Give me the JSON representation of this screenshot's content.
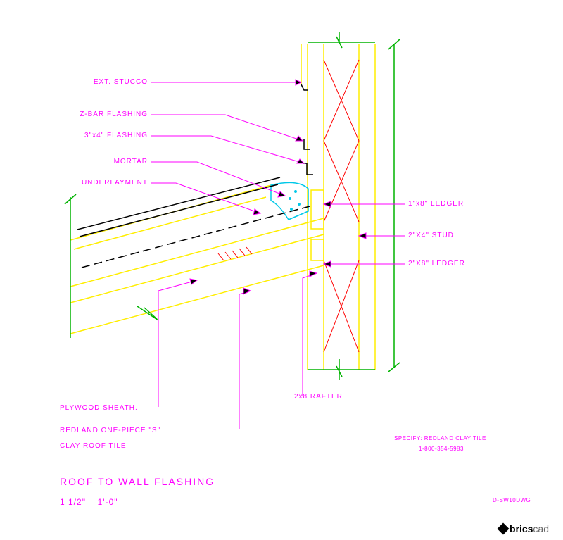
{
  "labels_left": [
    {
      "id": "ext-stucco",
      "text": "EXT. STUCCO"
    },
    {
      "id": "zbar-flashing",
      "text": "Z-BAR FLASHING"
    },
    {
      "id": "3x4-flashing",
      "text": "3\"x4\" FLASHING"
    },
    {
      "id": "mortar",
      "text": "MORTAR"
    },
    {
      "id": "underlayment",
      "text": "UNDERLAYMENT"
    }
  ],
  "labels_right": [
    {
      "id": "ledger-1x8",
      "text": "1\"x8\" LEDGER"
    },
    {
      "id": "stud-2x4",
      "text": "2\"X4\" STUD"
    },
    {
      "id": "ledger-2x8",
      "text": "2\"X8\" LEDGER"
    }
  ],
  "labels_bottom": [
    {
      "id": "plywood-sheath",
      "text": "PLYWOOD SHEATH."
    },
    {
      "id": "roof-tile-l1",
      "text": "REDLAND ONE-PIECE \"S\""
    },
    {
      "id": "roof-tile-l2",
      "text": "CLAY ROOF TILE"
    },
    {
      "id": "rafter-2x8",
      "text": "2x8 RAFTER"
    }
  ],
  "title": "ROOF TO WALL FLASHING",
  "scale": "1 1/2\" = 1'-0\"",
  "specify": {
    "line1": "SPECIFY: REDLAND CLAY TILE",
    "line2": "1-800-354-5983"
  },
  "doc_number": "D-SW10DWG",
  "brand": {
    "name": "bricscad"
  },
  "colors": {
    "magenta": "#ff00ff",
    "yellow": "#ffee00",
    "green": "#00b300",
    "red": "#ff0000",
    "cyan": "#00c8e8",
    "black": "#000000"
  }
}
